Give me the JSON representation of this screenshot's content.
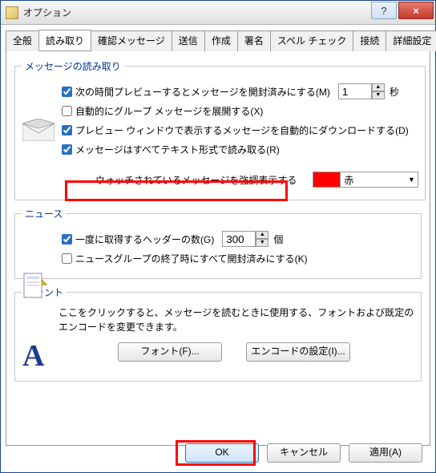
{
  "window": {
    "title": "オプション"
  },
  "titlebar_buttons": {
    "help": "?",
    "close": "×"
  },
  "tabs": {
    "general": "全般",
    "read": "読み取り",
    "confirm": "確認メッセージ",
    "send": "送信",
    "create": "作成",
    "sign": "署名",
    "spell": "スペル チェック",
    "connect": "接続",
    "advanced": "詳細設定"
  },
  "read_group": {
    "legend": "メッセージの読み取り",
    "preview_mark": {
      "label": "次の時間プレビューするとメッセージを開封済みにする(M)",
      "seconds_value": "1",
      "seconds_suffix": "秒",
      "checked": true
    },
    "auto_expand": {
      "label": "自動的にグループ メッセージを展開する(X)",
      "checked": false
    },
    "preview_dl": {
      "label": "プレビュー ウィンドウで表示するメッセージを自動的にダウンロードする(D)",
      "checked": true
    },
    "plain_text": {
      "label": "メッセージはすべてテキスト形式で読み取る(R)",
      "checked": true
    },
    "watched": {
      "label": "ウォッチされているメッセージを強調表示する",
      "color_name": "赤"
    }
  },
  "news_group": {
    "legend": "ニュース",
    "headers": {
      "label": "一度に取得するヘッダーの数(G)",
      "value": "300",
      "suffix": "個",
      "checked": true
    },
    "mark_read": {
      "label": "ニュースグループの終了時にすべて開封済みにする(K)",
      "checked": false
    }
  },
  "font_group": {
    "legend": "フォント",
    "description": "ここをクリックすると、メッセージを読むときに使用する、フォントおよび既定のエンコードを変更できます。",
    "font_button": "フォント(F)...",
    "encoding_button": "エンコードの設定(I)..."
  },
  "footer": {
    "ok": "OK",
    "cancel": "キャンセル",
    "apply": "適用(A)"
  }
}
